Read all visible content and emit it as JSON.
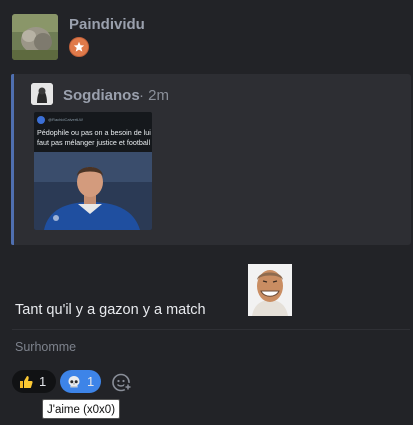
{
  "post": {
    "author": "Paindividu",
    "message": "Tant qu'il y a gazon y a match",
    "signature": "Surhomme"
  },
  "quote": {
    "author": "Sogdianos",
    "time": "· 2m",
    "tweet": {
      "handle": "@RachidCalvertLW",
      "text": "Pédophile ou pas on a besoin de lui faut pas mélanger justice et football"
    }
  },
  "reactions": [
    {
      "icon": "thumbs-up-icon",
      "count": "1"
    },
    {
      "icon": "skull-icon",
      "count": "1"
    }
  ],
  "tooltip": "J'aime (x0x0)",
  "colors": {
    "background": "#222327",
    "quote_background": "#2d2e33",
    "quote_bar": "#4f6fb0",
    "selected_reaction": "#3d84e8",
    "rank_badge": "#e07a4a"
  }
}
